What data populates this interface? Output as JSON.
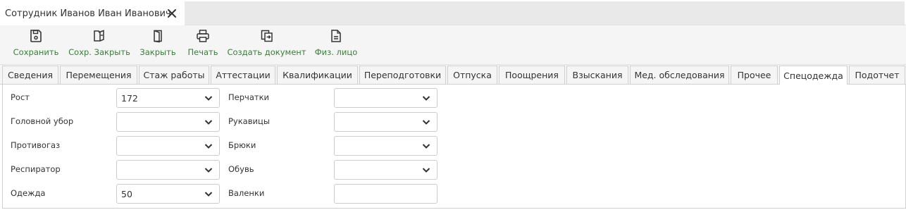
{
  "doc_tab": {
    "title": "Сотрудник Иванов Иван Иванович"
  },
  "toolbar": {
    "save_label": "Сохранить",
    "save_close_label": "Сохр. Закрыть",
    "close_label": "Закрыть",
    "print_label": "Печать",
    "create_doc_label": "Создать документ",
    "person_label": "Физ. лицо",
    "label_color": "#3a7d3a"
  },
  "tabs": [
    {
      "label": "Сведения"
    },
    {
      "label": "Перемещения"
    },
    {
      "label": "Стаж работы"
    },
    {
      "label": "Аттестации"
    },
    {
      "label": "Квалификации"
    },
    {
      "label": "Переподготовки"
    },
    {
      "label": "Отпуска"
    },
    {
      "label": "Поощрения"
    },
    {
      "label": "Взыскания"
    },
    {
      "label": "Мед. обследования"
    },
    {
      "label": "Прочее"
    },
    {
      "label": "Спецодежда",
      "active": true
    },
    {
      "label": "Подотчет"
    }
  ],
  "form": {
    "left": [
      {
        "label": "Рост",
        "value": "172"
      },
      {
        "label": "Головной убор",
        "value": ""
      },
      {
        "label": "Противогаз",
        "value": ""
      },
      {
        "label": "Респиратор",
        "value": ""
      },
      {
        "label": "Одежда",
        "value": "50"
      }
    ],
    "right": [
      {
        "label": "Перчатки",
        "value": ""
      },
      {
        "label": "Рукавицы",
        "value": ""
      },
      {
        "label": "Брюки",
        "value": ""
      },
      {
        "label": "Обувь",
        "value": ""
      },
      {
        "label": "Валенки",
        "value": ""
      }
    ]
  }
}
